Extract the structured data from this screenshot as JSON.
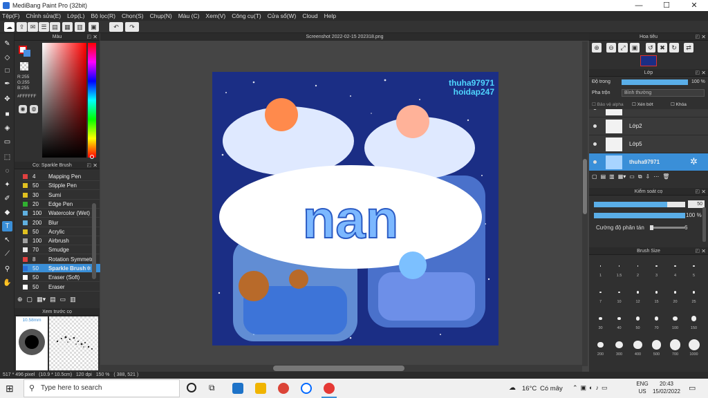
{
  "window": {
    "title": "MediBang Paint Pro (32bit)",
    "min": "—",
    "max": "☐",
    "close": "✕"
  },
  "menu": [
    "Tệp(F)",
    "Chỉnh sửa(E)",
    "Lớp(L)",
    "Bộ lọc(R)",
    "Chọn(S)",
    "Chụp(N)",
    "Màu (C)",
    "Xem(V)",
    "Công cụ(T)",
    "Cửa sổ(W)",
    "Cloud",
    "Help"
  ],
  "color_panel": {
    "title": "Màu",
    "r": "R:255",
    "g": "G:255",
    "b": "B:255",
    "hex": "#FFFFFF",
    "accent": "#ff0000"
  },
  "brush_panel": {
    "title": "Cọ: Sparkle Brush",
    "items": [
      {
        "size": "4",
        "name": "Mapping Pen",
        "color": "#e04040"
      },
      {
        "size": "50",
        "name": "Stipple Pen",
        "color": "#e0c020"
      },
      {
        "size": "30",
        "name": "Sumi",
        "color": "#e0c020"
      },
      {
        "size": "20",
        "name": "Edge Pen",
        "color": "#30b030"
      },
      {
        "size": "100",
        "name": "Watercolor (Wet)",
        "color": "#60b0e0"
      },
      {
        "size": "200",
        "name": "Blur",
        "color": "#60b0e0"
      },
      {
        "size": "50",
        "name": "Acrylic",
        "color": "#e0c020"
      },
      {
        "size": "100",
        "name": "Airbrush",
        "color": "#a0a0a0"
      },
      {
        "size": "70",
        "name": "Smudge",
        "color": "#e8e8e8"
      },
      {
        "size": "8",
        "name": "Rotation Symmetry",
        "color": "#e04040"
      },
      {
        "size": "50",
        "name": "Sparkle Brush",
        "color": "#2a6dd6"
      },
      {
        "size": "50",
        "name": "Eraser (Soft)",
        "color": "#ffffff"
      },
      {
        "size": "50",
        "name": "Eraser",
        "color": "#ffffff"
      }
    ]
  },
  "preview_panel": {
    "title": "Xem trước cọ",
    "size": "10.58mm"
  },
  "document": {
    "tab": "Screenshot 2022-02-15 202318.png",
    "watermark1": "thuha97971",
    "watermark2": "hoidap247",
    "art_text": "nan"
  },
  "navigator": {
    "title": "Hoa tiêu"
  },
  "layer_panel": {
    "title": "Lớp",
    "opacity_label": "Độ trong",
    "opacity_value": "100 %",
    "opacity": 1.0,
    "blend_label": "Pha trộn",
    "blend_value": "Bình thường",
    "protect_alpha": "Bảo vệ alpha",
    "clipping": "Xén bớt",
    "lock": "Khóa",
    "layers": [
      {
        "name": ""
      },
      {
        "name": "Lớp2"
      },
      {
        "name": "Lớp5"
      },
      {
        "name": "thuha97971"
      }
    ]
  },
  "brush_control": {
    "title": "Kiểm soát cọ",
    "size_value": "50",
    "size_fraction": 0.8,
    "opacity_value": "100 %",
    "opacity_fraction": 1.0,
    "scatter_label": "Cường độ phân tán",
    "scatter_value": "6"
  },
  "brush_size": {
    "title": "Brush Size",
    "sizes": [
      "1",
      "1.5",
      "2",
      "3",
      "4",
      "5",
      "7",
      "10",
      "12",
      "15",
      "20",
      "25",
      "30",
      "40",
      "50",
      "70",
      "100",
      "150",
      "200",
      "300",
      "400",
      "500",
      "700",
      "1000"
    ]
  },
  "status": {
    "dims": "517 * 496 pixel",
    "cm": "(10.9 * 10.5cm)",
    "dpi": "120 dpi",
    "zoom": "150 %",
    "coords": "( 388, 521 )"
  },
  "taskbar": {
    "search": "Type here to search",
    "temp": "16°C",
    "weather": "Có mây",
    "lang1": "ENG",
    "lang2": "US",
    "time": "20:43",
    "date": "15/02/2022"
  }
}
